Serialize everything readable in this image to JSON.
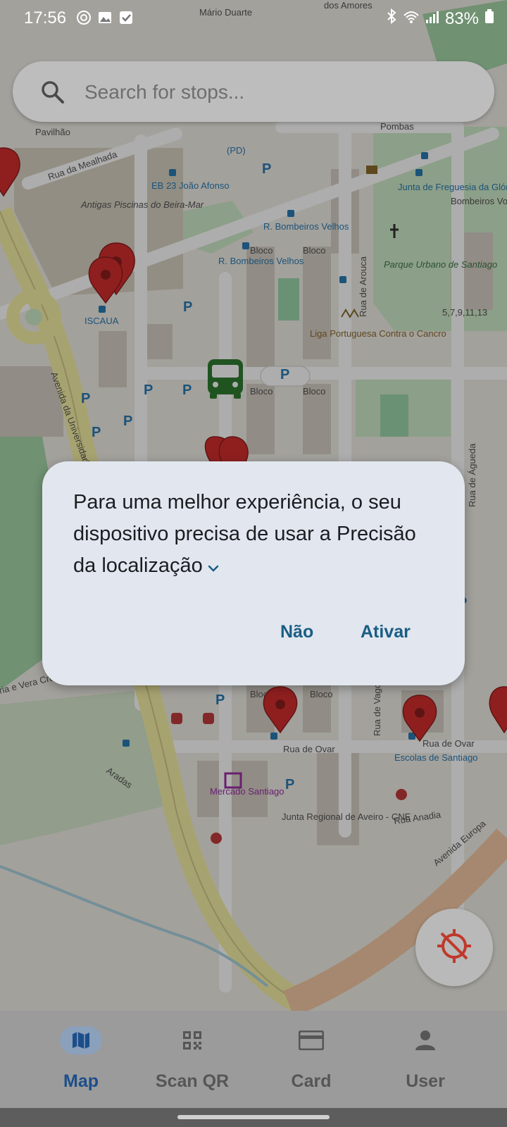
{
  "status_bar": {
    "time": "17:56",
    "battery": "83%"
  },
  "search": {
    "placeholder": "Search for stops..."
  },
  "map": {
    "labels": {
      "mario_duarte": "Mário Duarte",
      "rua_mealhada": "Rua da Mealhada",
      "pavilhao": "Pavilhão",
      "antigas_piscinas": "Antigas Piscinas do Beira-Mar",
      "eb23": "EB 23 João Afonso",
      "pd": "(PD)",
      "iscaa": "ISCAUA",
      "rbv1": "R. Bombeiros Velhos",
      "rbv2": "R. Bombeiros Velhos",
      "junta_gloria": "Junta de Freguesia da Glória",
      "bombeiros": "Bombeiros Voluntários de Aveiro Velhos",
      "parque": "Parque Urbano de Santiago",
      "rua_arouca": "Rua de Arouca",
      "liga": "Liga Portuguesa Contra o Cancro",
      "avenida_univ": "Avenida da Universidade",
      "rua_ovar1": "Rua de Ovar",
      "rua_ovar2": "Rua de Ovar",
      "escolas": "Escolas de Santiago",
      "rua_anadia": "Rua Anadia",
      "mercado": "Mercado Santiago",
      "junta_aveiro": "Junta Regional de Aveiro - CNE",
      "rua_vagos": "Rua de Vagos",
      "rua_agueda": "Rua de Águeda",
      "vera_cruz": "ria e Vera Cruz",
      "aradas": "Aradas",
      "avenida_europa": "Avenida Europa",
      "numbers": "5,7,9,11,13",
      "pombas": "Pombas",
      "amores": "dos Amores",
      "bloco": "Bloco"
    }
  },
  "dialog": {
    "message": "Para uma melhor experiência, o seu dispositivo precisa de usar a Precisão da localização",
    "cancel_label": "Não",
    "confirm_label": "Ativar"
  },
  "nav": {
    "items": [
      {
        "label": "Map",
        "icon": "map-icon",
        "active": true
      },
      {
        "label": "Scan QR",
        "icon": "qr-code-icon",
        "active": false
      },
      {
        "label": "Card",
        "icon": "card-icon",
        "active": false
      },
      {
        "label": "User",
        "icon": "user-icon",
        "active": false
      }
    ]
  },
  "colors": {
    "accent": "#1a5d84",
    "nav_active": "#1c4e8a",
    "pin": "#d32f2f",
    "bus": "#2e7d32"
  }
}
